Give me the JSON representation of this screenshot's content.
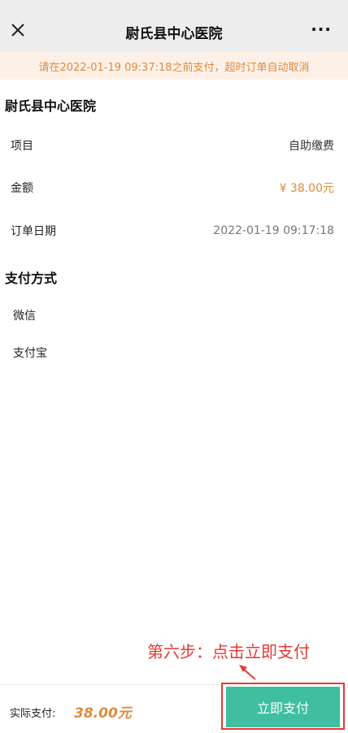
{
  "nav": {
    "title": "尉氏县中心医院",
    "more": "···"
  },
  "notice": "请在2022-01-19 09:37:18之前支付，超时订单自动取消",
  "hospital_name": "尉氏县中心医院",
  "order": {
    "rows": [
      {
        "label": "项目",
        "value": "自助缴费"
      },
      {
        "label": "金额",
        "value": "¥ 38.00元"
      },
      {
        "label": "订单日期",
        "value": "2022-01-19 09:17:18"
      }
    ]
  },
  "payment": {
    "section_title": "支付方式",
    "methods": [
      "微信",
      "支付宝"
    ]
  },
  "annotation": "第六步：点击立即支付",
  "footer": {
    "label": "实际支付:",
    "total": "38.00元",
    "pay_button": "立即支付"
  },
  "colors": {
    "accent": "#e18a3b",
    "button": "#3fbf9f",
    "annotation": "#e53935"
  },
  "icons": [
    "close-icon",
    "more-icon",
    "arrow-icon"
  ]
}
